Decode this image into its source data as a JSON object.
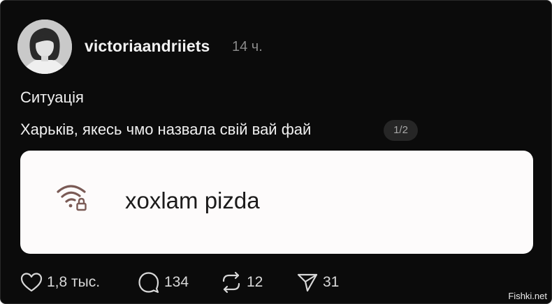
{
  "post": {
    "username": "victoriaandriiets",
    "timestamp": "14 ч.",
    "text_line1": "Ситуація",
    "text_line2": "Харьків, якесь чмо назвала свій вай фай",
    "pager": "1/2"
  },
  "media": {
    "network_name": "xoxlam pizda",
    "icon": "wifi-lock-icon",
    "icon_color": "#7a5a55"
  },
  "actions": {
    "likes": "1,8 тыс.",
    "comments": "134",
    "reposts": "12",
    "shares": "31"
  },
  "watermark": "Fishki.net"
}
